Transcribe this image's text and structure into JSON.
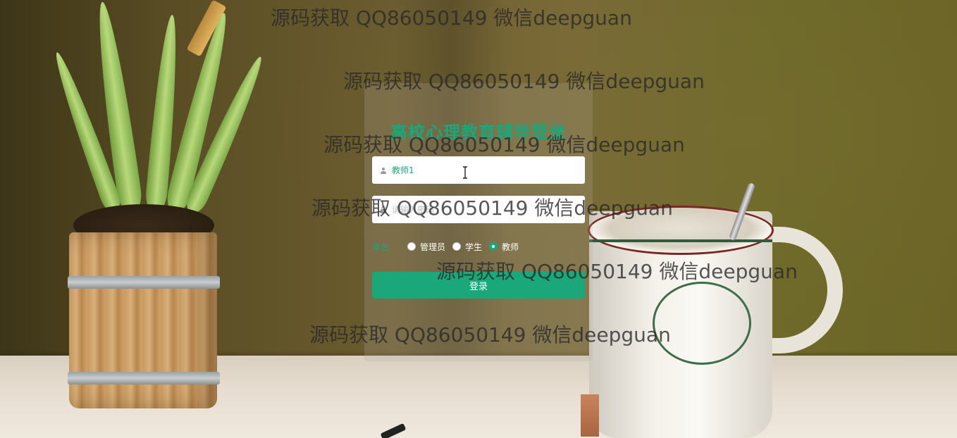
{
  "login": {
    "title": "高校心理教育辅导登录",
    "username_value": "教师1",
    "password_placeholder": "请输入密码",
    "role_label": "角色",
    "roles": [
      {
        "label": "管理员",
        "checked": false
      },
      {
        "label": "学生",
        "checked": false
      },
      {
        "label": "教师",
        "checked": true
      }
    ],
    "submit_label": "登录"
  },
  "watermark": "源码获取 QQ86050149 微信deepguan",
  "colors": {
    "accent": "#1aa87a",
    "card": "rgba(180,175,165,0.22)"
  },
  "icons": {
    "username": "user-icon",
    "password": "lock-icon",
    "cursor": "text-cursor-icon"
  }
}
